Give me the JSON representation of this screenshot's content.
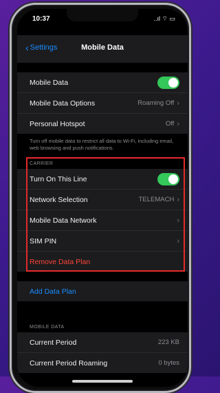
{
  "status": {
    "time": "10:37",
    "right_icons": "..ıl ⌔ ▭"
  },
  "nav": {
    "back_label": "Settings",
    "title": "Mobile Data"
  },
  "main_group": [
    {
      "label": "Mobile Data",
      "type": "toggle",
      "on": true
    },
    {
      "label": "Mobile Data Options",
      "value": "Roaming Off"
    },
    {
      "label": "Personal Hotspot",
      "value": "Off"
    }
  ],
  "note": "Turn off mobile data to restrict all data to Wi-Fi, including email, web browsing and push notifications.",
  "carrier": {
    "header": "CARRIER",
    "rows": [
      {
        "label": "Turn On This Line",
        "type": "toggle",
        "on": true
      },
      {
        "label": "Network Selection",
        "value": "TELEMACH"
      },
      {
        "label": "Mobile Data Network",
        "value": ""
      },
      {
        "label": "SIM PIN",
        "value": ""
      },
      {
        "label": "Remove Data Plan"
      }
    ]
  },
  "add_plan": "Add Data Plan",
  "mobile_data_section": {
    "header": "MOBILE DATA",
    "rows": [
      {
        "label": "Current Period",
        "value": "223 KB"
      },
      {
        "label": "Current Period Roaming",
        "value": "0 bytes"
      }
    ]
  },
  "colors": {
    "accent": "#1a8cff",
    "toggle_on": "#34c759",
    "destructive": "#ff453a",
    "highlight_box": "#e62a2a"
  }
}
